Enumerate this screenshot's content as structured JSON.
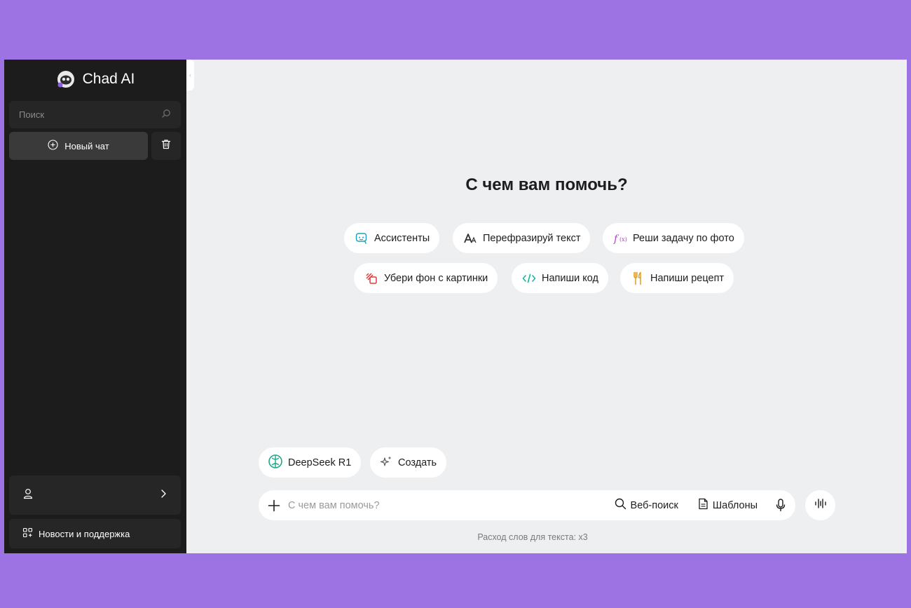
{
  "app": {
    "brand": "Chad AI"
  },
  "sidebar": {
    "search_placeholder": "Поиск",
    "new_chat_label": "Новый чат",
    "news_label": "Новости и поддержка"
  },
  "main": {
    "headline": "С чем вам помочь?",
    "suggestions": [
      {
        "label": "Ассистенты",
        "icon": "assistant-icon",
        "color": "#1aa3c8"
      },
      {
        "label": "Перефразируй текст",
        "icon": "font-size-icon",
        "color": "#333333"
      },
      {
        "label": "Реши задачу по фото",
        "icon": "function-icon",
        "color": "#b23fc9"
      },
      {
        "label": "Убери фон с картинки",
        "icon": "remove-background-icon",
        "color": "#e03a3a"
      },
      {
        "label": "Напиши код",
        "icon": "code-icon",
        "color": "#19b3a6"
      },
      {
        "label": "Напиши рецепт",
        "icon": "fork-knife-icon",
        "color": "#e0a020"
      }
    ],
    "model_label": "DeepSeek R1",
    "create_label": "Создать",
    "composer": {
      "placeholder": "С чем вам помочь?",
      "web_search_label": "Веб-поиск",
      "templates_label": "Шаблоны"
    },
    "footnote": "Расход слов для текста: x3"
  },
  "colors": {
    "page_background": "#9d72e3",
    "sidebar_background": "#1c1c1c",
    "main_background": "#eeeff1"
  }
}
